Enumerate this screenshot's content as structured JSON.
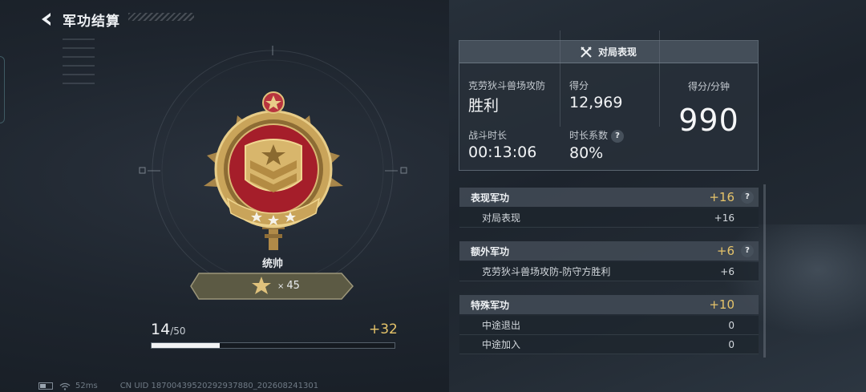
{
  "header": {
    "title": "军功结算"
  },
  "medal": {
    "rank_name": "统帅",
    "star_count": "45",
    "star_prefix": "×"
  },
  "progress": {
    "current": "14",
    "max": "/50",
    "gain": "+32",
    "fraction": 0.28
  },
  "footer": {
    "ping": "52ms",
    "uid": "CN UID 18700439520292937880_202608241301"
  },
  "match_panel": {
    "title": "对局表现",
    "mode_label": "克劳狄斗兽场攻防",
    "result": "胜利",
    "score_label": "得分",
    "score": "12,969",
    "duration_label": "战斗时长",
    "duration": "00:13:06",
    "coef_label": "时长系数",
    "coef": "80%",
    "spm_label": "得分/分钟",
    "spm": "990"
  },
  "merits": [
    {
      "name": "表现军功",
      "points": "+16",
      "has_help": true,
      "rows": [
        {
          "name": "对局表现",
          "points": "+16"
        }
      ]
    },
    {
      "name": "额外军功",
      "points": "+6",
      "has_help": true,
      "rows": [
        {
          "name": "克劳狄斗兽场攻防-防守方胜利",
          "points": "+6"
        }
      ]
    },
    {
      "name": "特殊军功",
      "points": "+10",
      "has_help": false,
      "rows": [
        {
          "name": "中途退出",
          "points": "0"
        },
        {
          "name": "中途加入",
          "points": "0"
        }
      ]
    }
  ],
  "help_glyph": "?",
  "colors": {
    "accent_gold": "#e6c46a",
    "medal_red": "#a51e2a",
    "medal_gold": "#c9a45a"
  }
}
